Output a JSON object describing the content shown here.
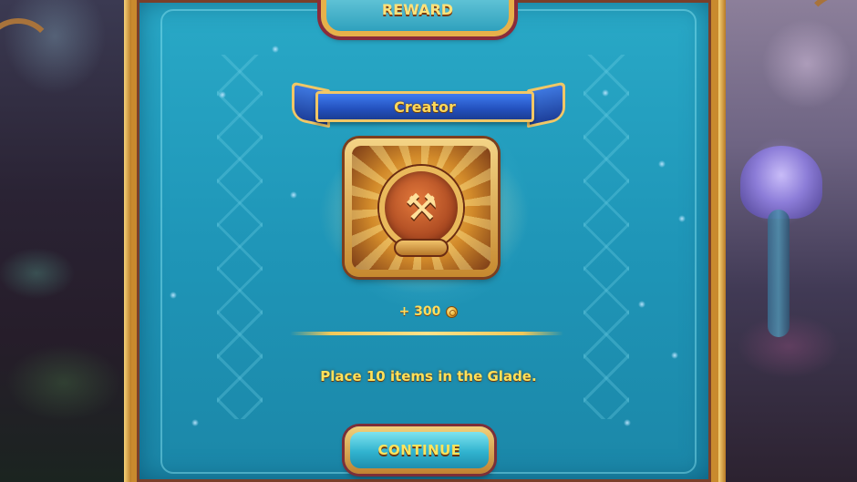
{
  "header": {
    "top_button_label": "REWARD"
  },
  "achievement": {
    "title": "Creator",
    "badge_icon": "hammer-saw-tools-icon",
    "reward_text": "+ 300",
    "reward_currency_icon": "coin-icon",
    "description": "Place 10 items in the Glade."
  },
  "actions": {
    "continue_label": "CONTINUE"
  },
  "colors": {
    "panel": "#1f96b8",
    "frame_gold": "#e7b14a",
    "ribbon_blue": "#2350bd",
    "text_gold": "#ffde5e"
  }
}
